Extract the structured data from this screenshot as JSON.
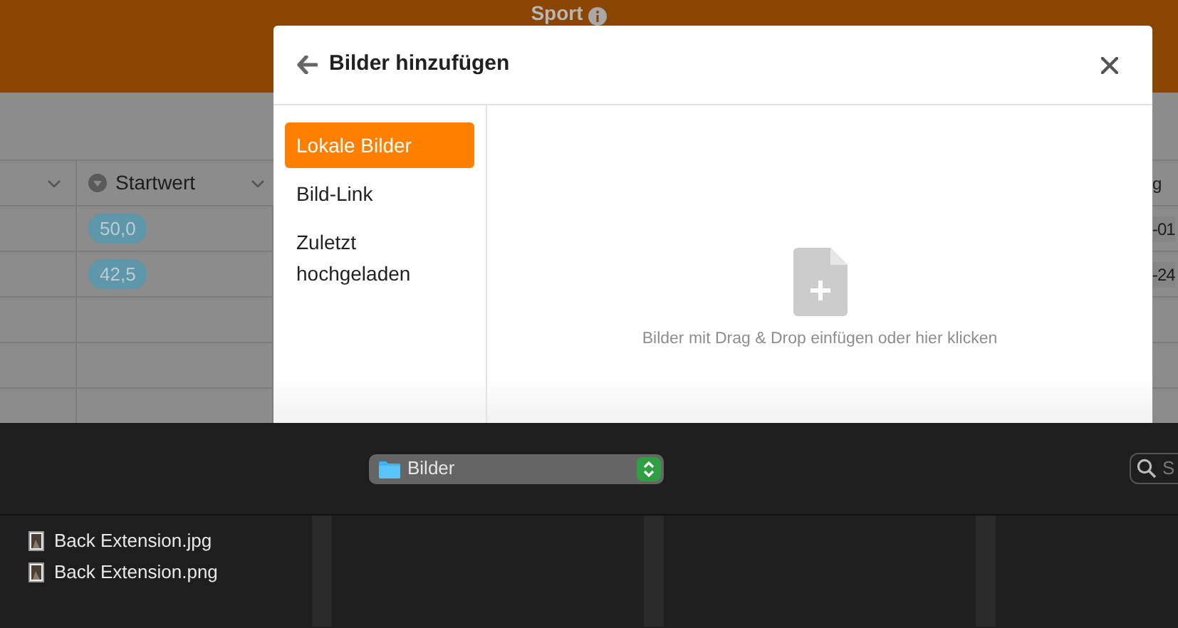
{
  "app": {
    "title": "Sport",
    "table": {
      "columns": [
        {
          "label": "Startwert"
        },
        {
          "label": "g"
        }
      ],
      "rows": [
        {
          "startwert": "50,0",
          "column_3": "-01"
        },
        {
          "startwert": "42,5",
          "column_3": "-24"
        }
      ]
    }
  },
  "dialog": {
    "title": "Bilder hinzufügen",
    "tabs": [
      {
        "label": "Lokale Bilder",
        "selected": true
      },
      {
        "label": "Bild-Link",
        "selected": false
      },
      {
        "label": "Zuletzt hochgeladen",
        "selected": false
      }
    ],
    "dropzone_hint": "Bilder mit Drag & Drop einfügen oder hier klicken"
  },
  "file_browser": {
    "location": "Bilder",
    "search": {
      "placeholder": "S"
    },
    "files": [
      "Back Extension.jpg",
      "Back Extension.png"
    ]
  }
}
